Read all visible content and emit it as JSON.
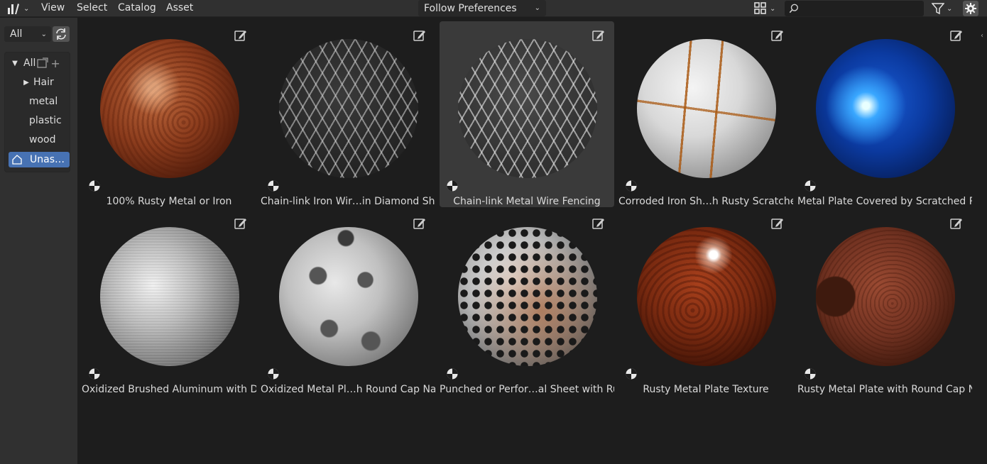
{
  "header": {
    "menus": [
      "View",
      "Select",
      "Catalog",
      "Asset"
    ],
    "import_method": "Follow Preferences",
    "search": {
      "value": "",
      "placeholder": ""
    }
  },
  "sidebar": {
    "library_scope": "All",
    "catalogs": [
      {
        "label": "All",
        "expanded": true,
        "level": 0
      },
      {
        "label": "Hair",
        "expanded": false,
        "level": 1
      },
      {
        "label": "metal",
        "level": 1
      },
      {
        "label": "plastic",
        "level": 1
      },
      {
        "label": "wood",
        "level": 1
      },
      {
        "label": "Unas…",
        "level": 1,
        "selected": true
      }
    ]
  },
  "assets": [
    {
      "name": "100% Rusty Metal or Iron",
      "material": "rust1"
    },
    {
      "name": "Chain-link Iron Wir…in Diamond Shape",
      "material": "chain1"
    },
    {
      "name": "Chain-link Metal Wire Fencing",
      "material": "chain2",
      "active": true
    },
    {
      "name": "Corroded Iron Sh…h Rusty Scratches",
      "material": "corroded"
    },
    {
      "name": "Metal Plate Covered by Scratched P…",
      "material": "blue"
    },
    {
      "name": "Oxidized Brushed Aluminum with Dirt",
      "material": "alum"
    },
    {
      "name": "Oxidized Metal Pl…h Round Cap Nails",
      "material": "nails"
    },
    {
      "name": "Punched or Perfor…al Sheet with Rust",
      "material": "punched"
    },
    {
      "name": "Rusty Metal Plate Texture",
      "material": "rustplate"
    },
    {
      "name": "Rusty Metal Plate with Round Cap N…",
      "material": "rustcap"
    }
  ],
  "colors": {
    "header_bg": "#303030",
    "grid_bg": "#1d1d1d",
    "selection": "#4772b3",
    "active_tile": "#3a3a3a"
  },
  "icons": [
    "editor-type-icon",
    "display-mode-icon",
    "search-icon",
    "filter-icon",
    "settings-gear-icon",
    "refresh-icon",
    "edit-asset-icon",
    "material-type-icon",
    "new-catalog-icon",
    "add-catalog-icon"
  ]
}
